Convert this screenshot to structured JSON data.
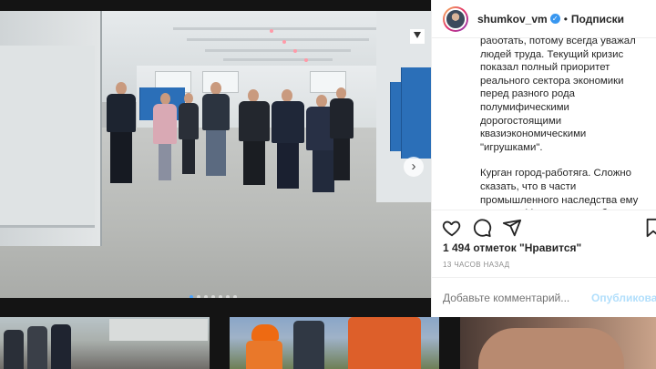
{
  "post": {
    "username": "shumkov_vm",
    "follow_separator": "•",
    "follow_label": "Подписки",
    "caption_paragraphs": [
      "работать, потому всегда уважал людей труда. Текущий кризис показал полный приоритет реального сектора экономики перед разного рода полумифическими дорогостоящими квазиэкономическими \"игрушками\".",
      "Курган город-работяга. Сложно сказать, что в части промышленного наследства ему повезло. Многие заводы были"
    ],
    "likes_text": "1 494 отметок \"Нравится\"",
    "time_text": "13 ЧАСОВ НАЗАД",
    "comment_placeholder": "Добавьте комментарий...",
    "publish_label": "Опубликовать"
  },
  "carousel": {
    "total_slides": 7,
    "active_slide": 1,
    "next_glyph": "›"
  },
  "icons": {
    "like": "heart-icon",
    "comment": "comment-icon",
    "share": "share-icon",
    "save": "bookmark-icon",
    "verified": "verified-badge-icon",
    "save_photo": "save-photo-icon"
  },
  "colors": {
    "link_blue": "#b2dffc",
    "verified_blue": "#3897f0",
    "carousel_active": "#4aa3ff"
  }
}
